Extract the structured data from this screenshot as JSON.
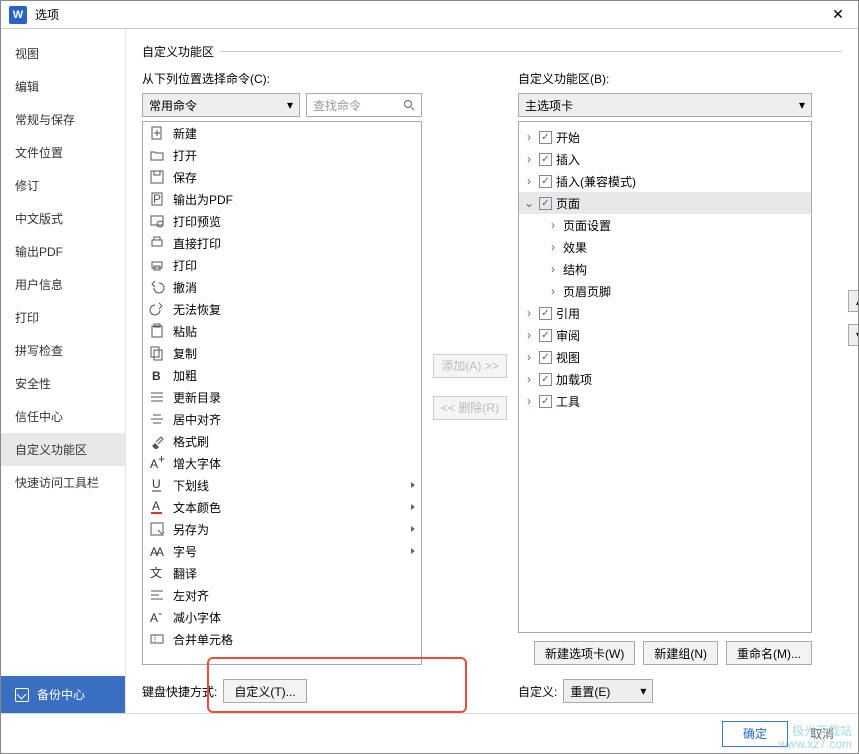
{
  "window": {
    "icon": "W",
    "title": "选项"
  },
  "sidebar": {
    "items": [
      {
        "label": "视图"
      },
      {
        "label": "编辑"
      },
      {
        "label": "常规与保存"
      },
      {
        "label": "文件位置"
      },
      {
        "label": "修订"
      },
      {
        "label": "中文版式"
      },
      {
        "label": "输出PDF"
      },
      {
        "label": "用户信息"
      },
      {
        "label": "打印"
      },
      {
        "label": "拼写检查"
      },
      {
        "label": "安全性"
      },
      {
        "label": "信任中心"
      },
      {
        "label": "自定义功能区"
      },
      {
        "label": "快速访问工具栏"
      }
    ],
    "active_index": 12,
    "backup_label": "备份中心"
  },
  "content": {
    "section_title": "自定义功能区",
    "left": {
      "label": "从下列位置选择命令(C):",
      "combo": "常用命令",
      "search_placeholder": "查找命令",
      "items": [
        {
          "icon": "new",
          "label": "新建"
        },
        {
          "icon": "open",
          "label": "打开"
        },
        {
          "icon": "save",
          "label": "保存"
        },
        {
          "icon": "pdf",
          "label": "输出为PDF"
        },
        {
          "icon": "preview",
          "label": "打印预览"
        },
        {
          "icon": "dprint",
          "label": "直接打印"
        },
        {
          "icon": "print",
          "label": "打印"
        },
        {
          "icon": "undo",
          "label": "撤消"
        },
        {
          "icon": "redo",
          "label": "无法恢复"
        },
        {
          "icon": "paste",
          "label": "粘贴"
        },
        {
          "icon": "copy",
          "label": "复制"
        },
        {
          "icon": "bold",
          "label": "加粗"
        },
        {
          "icon": "toc",
          "label": "更新目录"
        },
        {
          "icon": "center",
          "label": "居中对齐"
        },
        {
          "icon": "brush",
          "label": "格式刷"
        },
        {
          "icon": "aplus",
          "label": "增大字体"
        },
        {
          "icon": "underline",
          "label": "下划线",
          "submenu": true
        },
        {
          "icon": "fontcolor",
          "label": "文本颜色",
          "submenu": true
        },
        {
          "icon": "saveas",
          "label": "另存为",
          "submenu": true
        },
        {
          "icon": "fontsize",
          "label": "字号",
          "submenu": true
        },
        {
          "icon": "translate",
          "label": "翻译"
        },
        {
          "icon": "left",
          "label": "左对齐"
        },
        {
          "icon": "aminus",
          "label": "减小字体"
        },
        {
          "icon": "merge",
          "label": "合并单元格"
        }
      ]
    },
    "mid": {
      "add": "添加(A) >>",
      "remove": "<< 删除(R)"
    },
    "right": {
      "label": "自定义功能区(B):",
      "combo": "主选项卡",
      "tree": [
        {
          "tw": ">",
          "checked": true,
          "label": "开始"
        },
        {
          "tw": ">",
          "checked": true,
          "label": "插入"
        },
        {
          "tw": ">",
          "checked": true,
          "label": "插入(兼容模式)"
        },
        {
          "tw": "v",
          "checked": true,
          "label": "页面",
          "sel": true
        },
        {
          "tw": ">",
          "child": true,
          "label": "页面设置"
        },
        {
          "tw": ">",
          "child": true,
          "label": "效果"
        },
        {
          "tw": ">",
          "child": true,
          "label": "结构"
        },
        {
          "tw": ">",
          "child": true,
          "label": "页眉页脚"
        },
        {
          "tw": ">",
          "checked": true,
          "label": "引用"
        },
        {
          "tw": ">",
          "checked": true,
          "label": "审阅"
        },
        {
          "tw": ">",
          "checked": true,
          "label": "视图"
        },
        {
          "tw": ">",
          "checked": true,
          "label": "加载项"
        },
        {
          "tw": ">",
          "checked": true,
          "label": "工具"
        }
      ],
      "buttons": {
        "new_tab": "新建选项卡(W)",
        "new_group": "新建组(N)",
        "rename": "重命名(M)..."
      },
      "reset": {
        "label": "自定义:",
        "btn": "重置(E)"
      }
    },
    "kb": {
      "label": "键盘快捷方式:",
      "btn": "自定义(T)..."
    }
  },
  "footer": {
    "ok": "确定",
    "cancel": "取消"
  },
  "watermark": {
    "l1": "极光下载站",
    "l2": "www.xz7.com"
  }
}
